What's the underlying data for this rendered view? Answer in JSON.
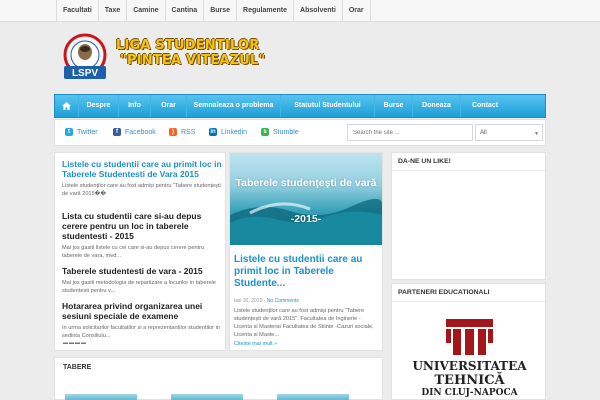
{
  "topnav": [
    "Facultati",
    "Taxe",
    "Camine",
    "Cantina",
    "Burse",
    "Regulamente",
    "Absolventi",
    "Orar"
  ],
  "logo": {
    "badge_top": "PRIN LIDER, PRIN NOI",
    "badge_text": "LSPV",
    "line1": "LIGA STUDENTILOR",
    "line2": "\"PINTEA VITEAZUL\""
  },
  "mainnav": [
    "Despre",
    "Info",
    "Orar",
    "Semnaleaza o problema",
    "Statutul Studentului",
    "Burse",
    "Doneaza",
    "Contact"
  ],
  "social": [
    {
      "label": "Twitter",
      "icon": "twitter-icon",
      "color": "#2aa9e0"
    },
    {
      "label": "Facebook",
      "icon": "facebook-icon",
      "color": "#3b5998"
    },
    {
      "label": "RSS",
      "icon": "rss-icon",
      "color": "#f26522"
    },
    {
      "label": "Linkedin",
      "icon": "linkedin-icon",
      "color": "#0077b5"
    },
    {
      "label": "Stumble",
      "icon": "stumbleupon-icon",
      "color": "#3fb34f"
    }
  ],
  "search": {
    "placeholder": "Search the site ...",
    "filter_value": "All"
  },
  "posts": [
    {
      "title": "Listele cu studentii care au primit loc in Taberele Studentesti de Vara 2015",
      "excerpt": "Listele studenților care au fost admiși pentru  \"Tabere studențești de vară 2015��"
    },
    {
      "title": "Lista cu studentii care si-au depus cerere pentru un loc in taberele studentesti - 2015",
      "excerpt": "Mai jos gasiti listele cu cei care si-au depus cerere pentru taberele de vara, med..."
    },
    {
      "title": "Taberele studentesti de vara - 2015",
      "excerpt": "Mai jos gasiti metodologia de repartizare a locurilor in taberele studentesti pentru v..."
    },
    {
      "title": "Hotararea privind organizarea unei sesiuni speciale de examene",
      "excerpt": "In urma solicitarilor facultatilor si a reprezentantilor studentilor in sedinta Consiliulu..."
    }
  ],
  "featured": {
    "image_caption_1": "Taberele studenţeşti de vară",
    "image_caption_2": "-2015-",
    "title": "Listele cu studentii care au primit loc in Taberele Studente...",
    "date": "iasi 30, 2015",
    "comments": "No Comments",
    "excerpt": "Listele studenților care au fost admiși pentru \"Tabere studențești de vară 2015\". Facultatea de Inginerie - Licenta si Masterat Facultatea de Stiinte -Cazuri sociale, Licenta si Maste...",
    "read_more": "Citeste mai mult »"
  },
  "widgets": {
    "like": "DA-NE UN LIKE!",
    "partners": "PARTENERI EDUCATIONALI"
  },
  "partner": {
    "word1": "UNIVERSITATEA",
    "word2": "TEHNICĂ",
    "word3": "DIN CLUJ-NAPOCA"
  },
  "tabere": {
    "title": "TABERE"
  },
  "colors": {
    "nav_blue": "#1e9fd8",
    "link_blue": "#1b91cf",
    "logo_gold": "#f2c511",
    "utcn_red": "#a3161a"
  }
}
